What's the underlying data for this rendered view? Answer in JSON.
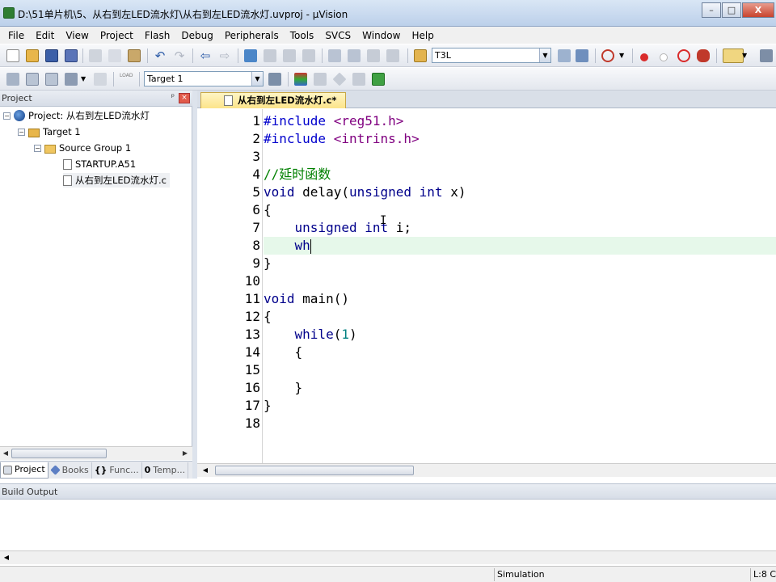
{
  "window": {
    "title": "D:\\51单片机\\5、从右到左LED流水灯\\从右到左LED流水灯.uvproj - µVision",
    "minimize": "–",
    "maximize": "□",
    "close": "X"
  },
  "menu": [
    "File",
    "Edit",
    "View",
    "Project",
    "Flash",
    "Debug",
    "Peripherals",
    "Tools",
    "SVCS",
    "Window",
    "Help"
  ],
  "toolbar": {
    "find_combo_value": "T3L",
    "target_combo_value": "Target 1",
    "load_label": "LOAD"
  },
  "project_panel": {
    "header": "Project",
    "pin": "ᵖ",
    "close": "×",
    "tree": [
      {
        "label": "Project: 从右到左LED流水灯",
        "level": 0
      },
      {
        "label": "Target 1",
        "level": 1
      },
      {
        "label": "Source Group 1",
        "level": 2
      },
      {
        "label": "STARTUP.A51",
        "level": 3
      },
      {
        "label": "从右到左LED流水灯.c",
        "level": 3
      }
    ],
    "tabs": [
      "Project",
      "Books",
      "Func...",
      "Temp..."
    ]
  },
  "editor": {
    "tab_label": "从右到左LED流水灯.c*",
    "line_numbers": [
      "1",
      "2",
      "3",
      "4",
      "5",
      "6",
      "7",
      "8",
      "9",
      "10",
      "11",
      "12",
      "13",
      "14",
      "15",
      "16",
      "17",
      "18"
    ],
    "current_line": 8
  },
  "build_output": {
    "header": "Build Output"
  },
  "status": {
    "mode": "Simulation",
    "position": "L:8 C:"
  },
  "colors": {
    "keyword": "#00008b",
    "string": "#800080",
    "comment": "#008000",
    "number": "#008080",
    "current_line_bg": "#e6f8ea",
    "tab_bg": "#fce48a"
  }
}
